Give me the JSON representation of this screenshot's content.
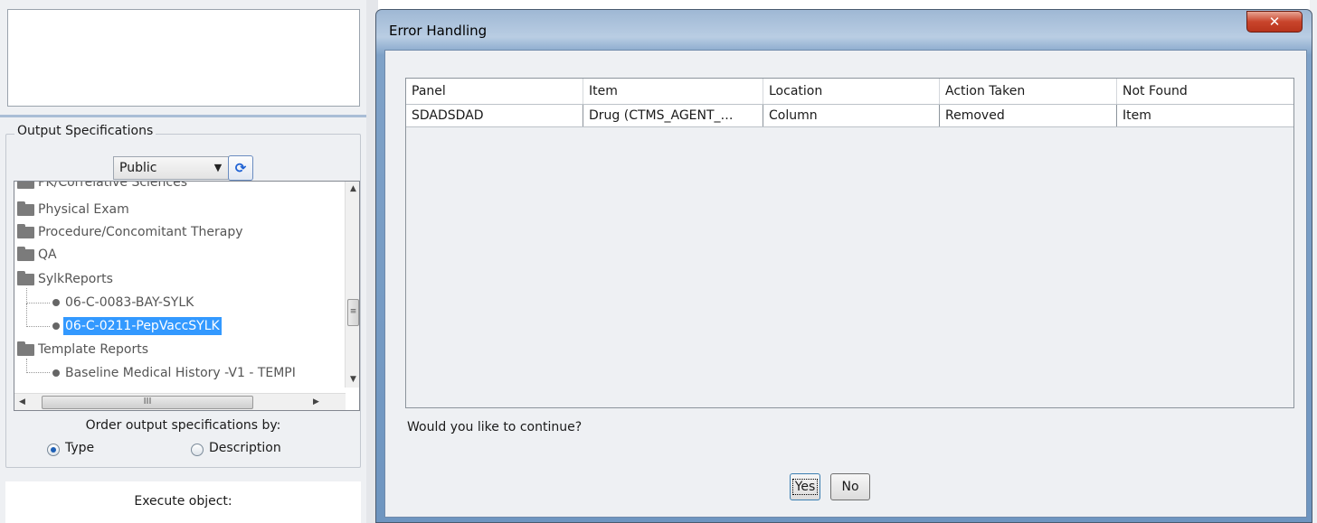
{
  "left_panel": {
    "group_title": "Output Specifications",
    "filter_value": "Public",
    "tree": [
      {
        "type": "folder",
        "label": "PK/Correlative Sciences"
      },
      {
        "type": "folder",
        "label": "Physical Exam"
      },
      {
        "type": "folder",
        "label": "Procedure/Concomitant Therapy"
      },
      {
        "type": "folder",
        "label": "QA"
      },
      {
        "type": "folder",
        "label": "SylkReports"
      },
      {
        "type": "leaf",
        "label": "06-C-0083-BAY-SYLK"
      },
      {
        "type": "leaf",
        "label": "06-C-0211-PepVaccSYLK",
        "selected": true
      },
      {
        "type": "folder",
        "label": "Template Reports"
      },
      {
        "type": "leaf",
        "label": "Baseline Medical History -V1 - TEMPI"
      }
    ],
    "order_label": "Order output specifications by:",
    "radio_type": "Type",
    "radio_description": "Description",
    "selected_order": "Type",
    "execute_label": "Execute object:"
  },
  "dialog": {
    "title": "Error Handling",
    "close_glyph": "✕",
    "columns": [
      "Panel",
      "Item",
      "Location",
      "Action Taken",
      "Not Found"
    ],
    "rows": [
      [
        "SDADSDAD",
        "Drug (CTMS_AGENT_…",
        "Column",
        "Removed",
        "Item"
      ]
    ],
    "question": "Would you like to continue?",
    "yes_label": "Yes",
    "no_label": "No"
  }
}
